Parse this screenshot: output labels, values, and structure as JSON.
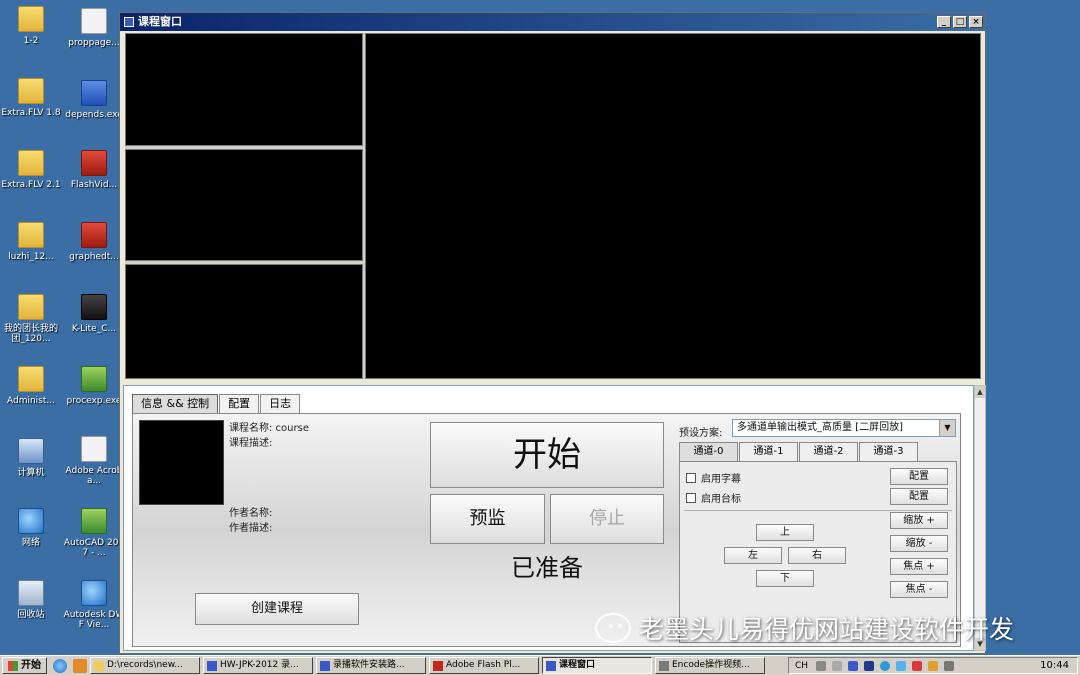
{
  "desktop": {
    "icons_col1": [
      {
        "label": "1-2",
        "icon": "folder-icon"
      },
      {
        "label": "Extra.FLV 1.8",
        "icon": "folder-icon"
      },
      {
        "label": "Extra.FLV 2.1",
        "icon": "folder-icon"
      },
      {
        "label": "luzhi_12...",
        "icon": "folder-icon"
      },
      {
        "label": "我的团长我的团_120...",
        "icon": "folder-icon"
      },
      {
        "label": "Administ...",
        "icon": "user-folder-icon"
      },
      {
        "label": "计算机",
        "icon": "computer-icon"
      },
      {
        "label": "网络",
        "icon": "network-icon"
      },
      {
        "label": "回收站",
        "icon": "recycle-bin-icon"
      }
    ],
    "icons_col2": [
      {
        "label": "proppage...",
        "icon": "propertypage-icon"
      },
      {
        "label": "depends.exe",
        "icon": "depends-icon"
      },
      {
        "label": "FlashVid...",
        "icon": "flash-icon"
      },
      {
        "label": "graphedt...",
        "icon": "graphedit-icon"
      },
      {
        "label": "K-Lite_C...",
        "icon": "klite-codec-icon"
      },
      {
        "label": "procexp.exe",
        "icon": "process-explorer-icon"
      },
      {
        "label": "Adobe Acroba...",
        "icon": "acrobat-icon"
      },
      {
        "label": "AutoCAD 2007 - ...",
        "icon": "autocad-icon"
      },
      {
        "label": "Autodesk DWF Vie...",
        "icon": "dwf-viewer-icon"
      }
    ]
  },
  "window": {
    "title": "课程窗口",
    "buttons": [
      "_",
      "□",
      "×"
    ]
  },
  "control": {
    "tabs": [
      "信息 && 控制",
      "配置",
      "日志"
    ],
    "active_tab": 0,
    "course_name_label": "课程名称: course",
    "course_desc_label": "课程描述:",
    "author_name_label": "作者名称:",
    "author_desc_label": "作者描述:",
    "create_button": "创建课程",
    "start_button": "开始",
    "preview_button": "预监",
    "stop_button": "停止",
    "status": "已准备",
    "preset_label": "预设方案:",
    "preset_value": "多通道单输出模式_高质量 [二屏回放]",
    "channel_tabs": [
      "通道-0",
      "通道-1",
      "通道-2",
      "通道-3"
    ],
    "active_channel": 0,
    "enable_subtitle": "启用字幕",
    "enable_logo": "启用台标",
    "config_button": "配置",
    "up": "上",
    "left": "左",
    "right": "右",
    "down": "下",
    "zoom_in": "缩放 +",
    "zoom_out": "缩放 -",
    "focus_in": "焦点 +",
    "focus_out": "焦点 -"
  },
  "watermark": "老墨头儿易得优网站建设软件开发",
  "taskbar": {
    "start": "开始",
    "tasks": [
      {
        "label": "D:\\records\\new...",
        "icon": "folder-icon",
        "active": false
      },
      {
        "label": "HW-JPK-2012 录...",
        "icon": "document-icon",
        "active": false
      },
      {
        "label": "录播软件安装路...",
        "icon": "document-icon",
        "active": false
      },
      {
        "label": "Adobe Flash Pl...",
        "icon": "flash-icon",
        "active": false
      },
      {
        "label": "课程窗口",
        "icon": "app-icon",
        "active": true
      },
      {
        "label": "Encode操作视频...",
        "icon": "video-icon",
        "active": false
      }
    ],
    "lang": "CH",
    "clock": "10:44"
  },
  "colors": {
    "desktop": "#3a6ea5",
    "titlebar": "#0a246a"
  }
}
